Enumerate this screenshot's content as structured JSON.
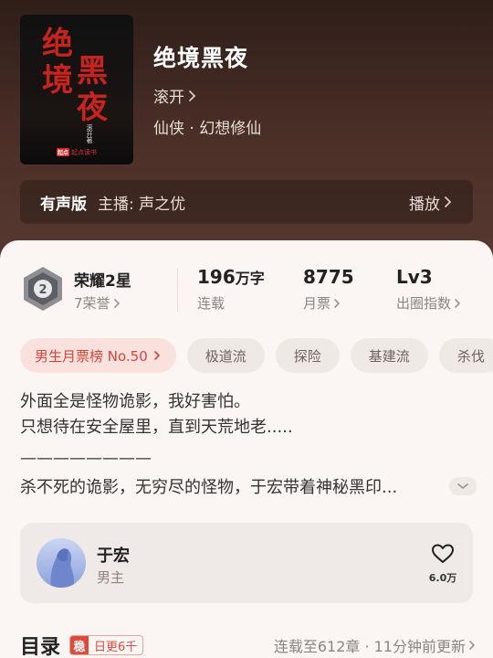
{
  "book": {
    "title": "绝境黑夜",
    "author": "滚开",
    "genre": "仙侠 · 幻想修仙",
    "cover": {
      "title_chars": [
        "绝",
        "境",
        "黑",
        "夜"
      ],
      "author_text": "滚开著",
      "publisher": "起点读书",
      "publisher_mark": "起点"
    }
  },
  "audio": {
    "tag": "有声版",
    "host": "主播: 声之优",
    "play_label": "播放"
  },
  "stats": {
    "honor_name": "荣耀2星",
    "honor_sub": "7荣誉",
    "words_num": "196",
    "words_unit": "万字",
    "words_label": "连载",
    "votes_num": "8775",
    "votes_label": "月票",
    "level_num": "Lv3",
    "level_label": "出圈指数"
  },
  "tags": {
    "rank": "男生月票榜 No.50",
    "items": [
      "极道流",
      "探险",
      "基建流",
      "杀伐"
    ]
  },
  "description": {
    "line1": "外面全是怪物诡影，我好害怕。",
    "line2": "只想待在安全屋里，直到天荒地老.....",
    "rule": "————————",
    "line3": "杀不死的诡影，无穷尽的怪物，于宏带着神秘黑印..."
  },
  "character": {
    "name": "于宏",
    "role": "男主",
    "likes": "6.0万"
  },
  "toc": {
    "heading": "目录",
    "badge_key": "稳",
    "badge_text": "日更6千",
    "status": "连载至612章 · 11分钟前更新"
  },
  "colors": {
    "accent": "#dd4a3b",
    "hero_bg": "#4a2f27",
    "sheet_bg": "#fbf6f4"
  }
}
